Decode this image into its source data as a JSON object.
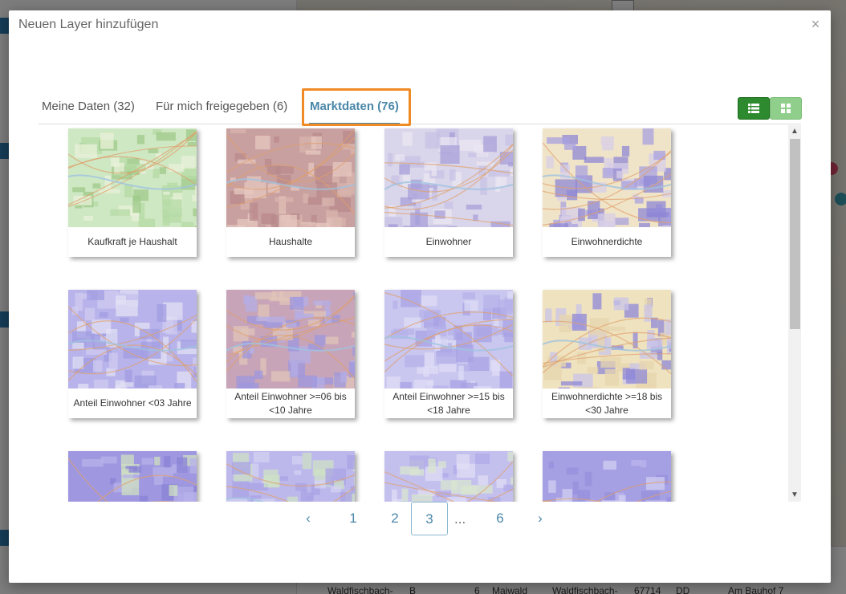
{
  "modal": {
    "title": "Neuen Layer hinzufügen",
    "close_glyph": "×"
  },
  "tabs": [
    {
      "label": "Meine Daten (32)",
      "active": false
    },
    {
      "label": "Für mich freigegeben (6)",
      "active": false
    },
    {
      "label": "Marktdaten (76)",
      "active": true
    }
  ],
  "view_toggle": {
    "list_icon": "list-icon",
    "grid_icon": "grid-icon",
    "active": "list"
  },
  "cards": [
    {
      "label": "Kaufkraft je Haushalt",
      "icon": "map-thumbnail"
    },
    {
      "label": "Haushalte",
      "icon": "map-thumbnail"
    },
    {
      "label": "Einwohner",
      "icon": "map-thumbnail"
    },
    {
      "label": "Einwohnerdichte",
      "icon": "map-thumbnail"
    },
    {
      "label": "Anteil Einwohner <03 Jahre",
      "icon": "map-thumbnail"
    },
    {
      "label": "Anteil Einwohner >=06 bis <10 Jahre",
      "icon": "map-thumbnail"
    },
    {
      "label": "Anteil Einwohner >=15 bis <18 Jahre",
      "icon": "map-thumbnail"
    },
    {
      "label": "Einwohnerdichte >=18 bis <30 Jahre",
      "icon": "map-thumbnail"
    },
    {
      "label": "",
      "icon": "map-thumbnail"
    },
    {
      "label": "",
      "icon": "map-thumbnail"
    },
    {
      "label": "",
      "icon": "map-thumbnail"
    },
    {
      "label": "",
      "icon": "map-thumbnail"
    }
  ],
  "pagination": {
    "prev": "‹",
    "pages": [
      "1",
      "2",
      "3"
    ],
    "ellipsis": "...",
    "last": "6",
    "next": "›",
    "current": "3"
  },
  "background": {
    "table_cells": [
      "Waldfischbach-",
      "B",
      "6",
      "Maiwald",
      "Waldfischbach-",
      "67714",
      "DD",
      "Am Bauhof 7"
    ]
  },
  "colors": {
    "accent": "#4b87a8",
    "highlight_box": "#f08a24",
    "toggle_active": "#2d8a2e",
    "toggle_inactive": "#8fce8b"
  }
}
